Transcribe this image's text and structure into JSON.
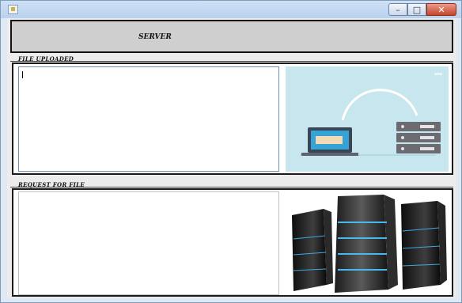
{
  "window": {
    "title": "",
    "controls": {
      "minimize": "–",
      "maximize": "□",
      "close": "✕"
    }
  },
  "header": {
    "title": "SERVER"
  },
  "uploaded_section": {
    "label": "FILE UPLOADED",
    "text_value": ""
  },
  "request_section": {
    "label": "REQUEST FOR FILE",
    "text_value": ""
  },
  "colors": {
    "illustration_bg": "#c7e6ee",
    "laptop_screen": "#35a3d6",
    "laptop_body": "#3a4656",
    "server_rack": "#6d6b72"
  },
  "icons": [
    "app-icon",
    "transfer-illustration",
    "server-rack-image"
  ]
}
